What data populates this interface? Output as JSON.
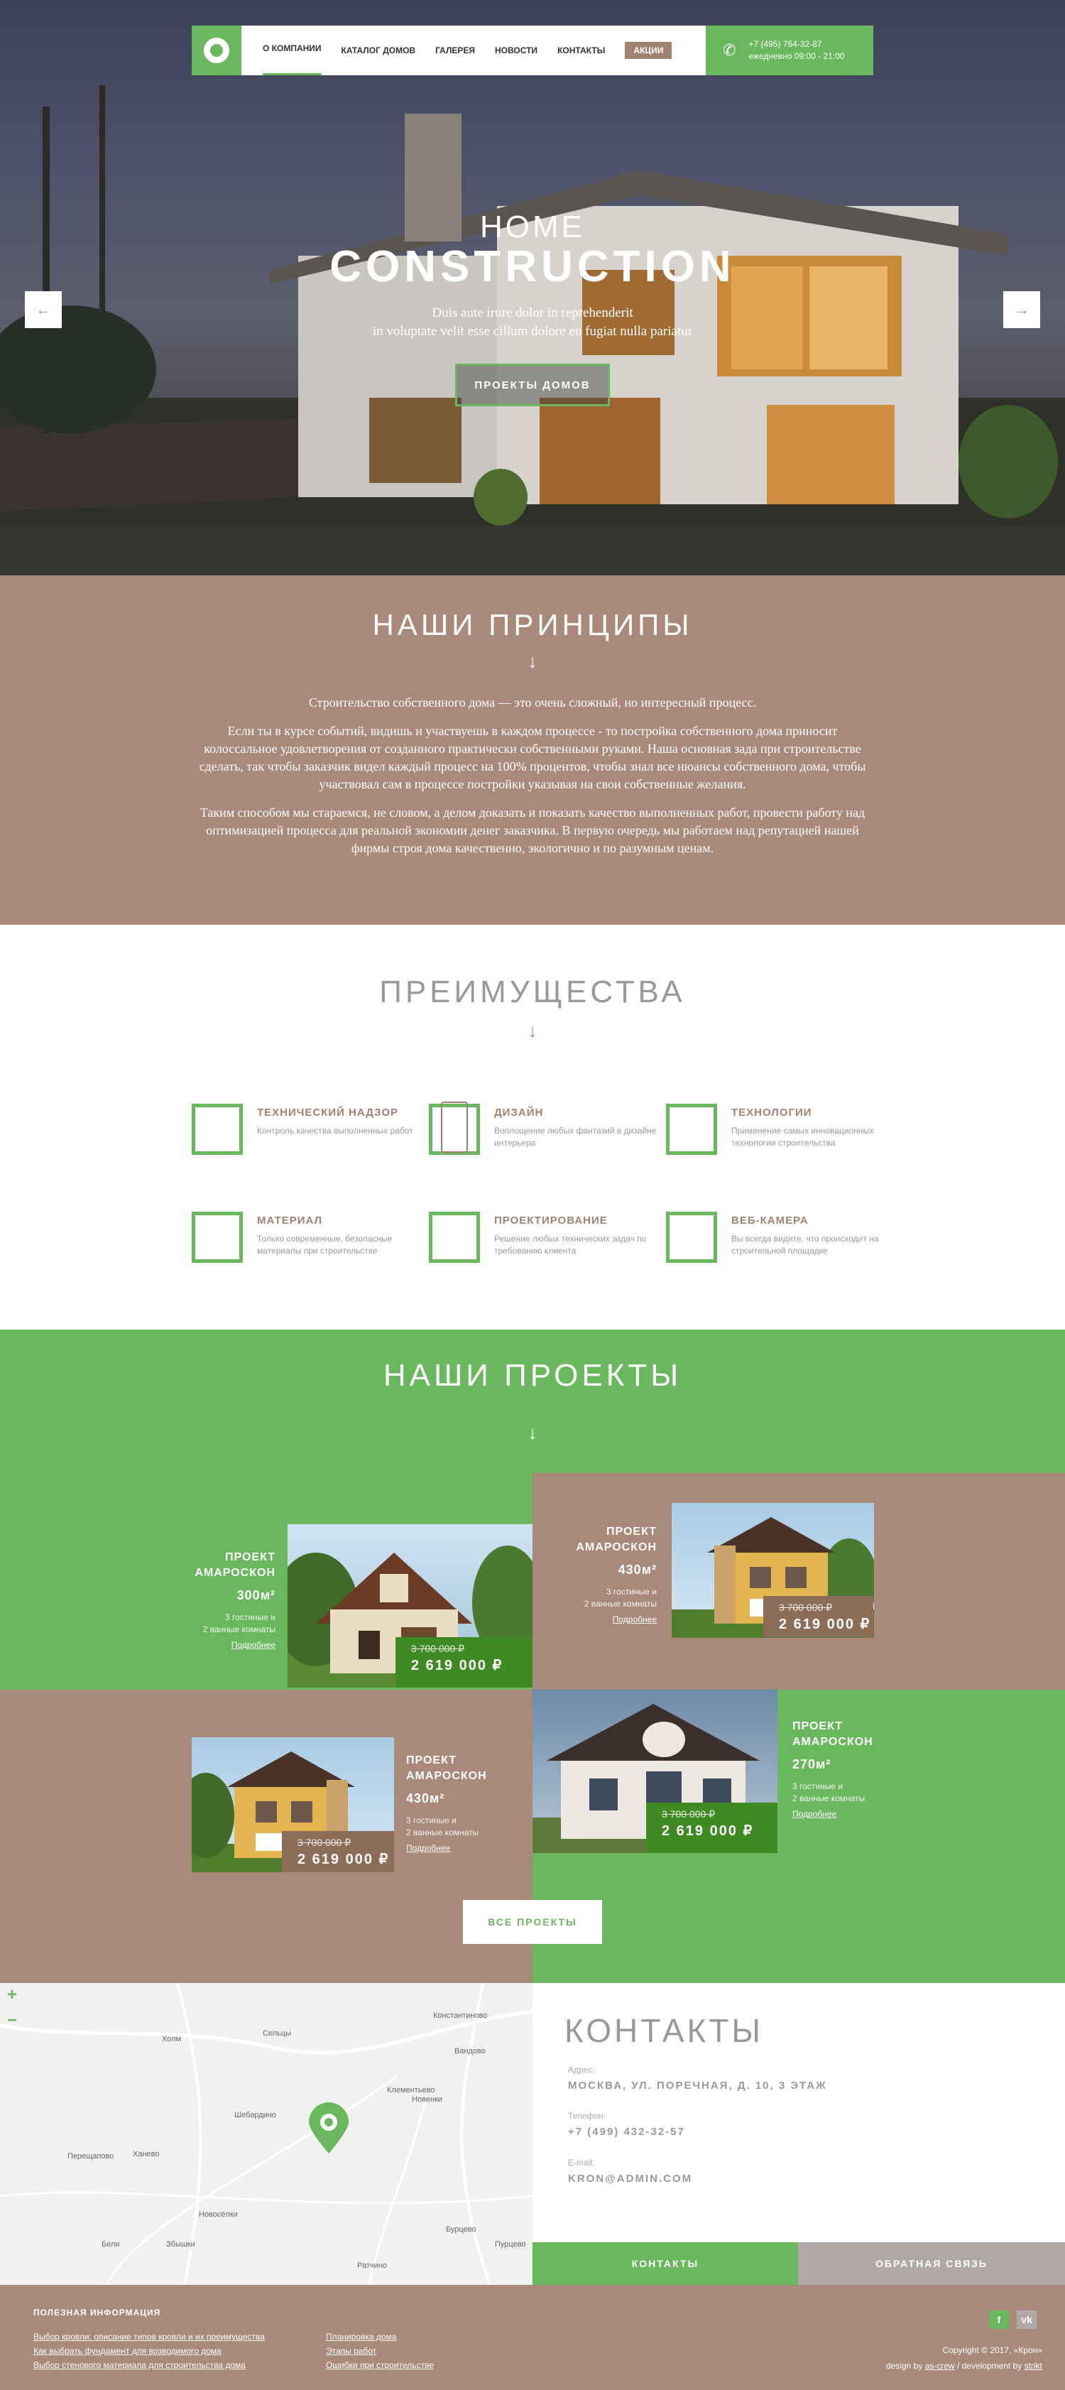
{
  "nav": {
    "items": [
      "О компании",
      "Каталог домов",
      "Галерея",
      "Новости",
      "Контакты"
    ],
    "promo": "Акции",
    "phone": "+7 (495) 764-32-87",
    "hours": "ежедневно 09:00 - 21:00"
  },
  "hero": {
    "title_small": "HOME",
    "title_big": "CONSTRUCTION",
    "subtitle_line1": "Duis aute irure dolor in reprehenderit",
    "subtitle_line2": "in voluptate velit esse cillum dolore eu fugiat nulla pariatur",
    "button": "ПРОЕКТЫ ДОМОВ",
    "prev": "←",
    "next": "→"
  },
  "principles": {
    "title": "НАШИ ПРИНЦИПЫ",
    "arrow": "↓",
    "p1": "Строительство собственного дома — это очень сложный, но интересный процесс.",
    "p2": "Если ты в курсе событий, видишь и участвуешь в каждом процессе - то постройка собственного дома приносит колоссальное удовлетворения от созданного практически собственными руками. Наша основная зада при строительстве сделать, так чтобы заказчик видел каждый процесс на 100% процентов, чтобы знал все нюансы собственного дома, чтобы участвовал сам в процессе постройки указывая на свои собственные желания.",
    "p3": "Таким способом мы стараемся, не словом, а делом доказать и показать качество выполненных работ, провести работу над оптимизацией процесса для реальной экономии денег заказчика. В первую очередь мы работаем над репутацией нашей фирмы строя дома качественно, экологично и по разумным ценам."
  },
  "advantages": {
    "title": "ПРЕИМУЩЕСТВА",
    "arrow": "↓",
    "items": [
      {
        "title": "Технический надзор",
        "desc": "Контроль качества выполненных работ"
      },
      {
        "title": "Дизайн",
        "desc": "Воплощение любых фантазий в дизайне интерьера"
      },
      {
        "title": "Технологии",
        "desc": "Применение самых инновационных технологии строительства"
      },
      {
        "title": "Материал",
        "desc": "Только современные, безопасные материалы при строительстве"
      },
      {
        "title": "Проектирование",
        "desc": "Решение любых технических задач по требованию клиента"
      },
      {
        "title": "Веб-камера",
        "desc": "Вы всегда видите, что происходит на строительной площадке"
      }
    ]
  },
  "projects": {
    "title": "НАШИ ПРОЕКТЫ",
    "arrow": "↓",
    "cards": [
      {
        "name_line1": "ПРОЕКТ",
        "name_line2": "АМАРОСКОН",
        "area": "300м²",
        "rooms_line1": "3 гостиные и",
        "rooms_line2": "2 ванные комнаты",
        "more": "Подробнее",
        "old_price": "3 700 000 ₽",
        "price": "2 619 000 ₽"
      },
      {
        "name_line1": "ПРОЕКТ",
        "name_line2": "АМАРОСКОН",
        "area": "430м²",
        "rooms_line1": "3 гостиные и",
        "rooms_line2": "2 ванные комнаты",
        "more": "Подробнее",
        "old_price": "3 700 000 ₽",
        "price": "2 619 000 ₽"
      },
      {
        "name_line1": "ПРОЕКТ",
        "name_line2": "АМАРОСКОН",
        "area": "430м²",
        "rooms_line1": "3 гостиные и",
        "rooms_line2": "2 ванные комнаты",
        "more": "Подробнее",
        "old_price": "3 700 000 ₽",
        "price": "2 619 000 ₽"
      },
      {
        "name_line1": "ПРОЕКТ",
        "name_line2": "АМАРОСКОН",
        "area": "270м²",
        "rooms_line1": "3 гостиные и",
        "rooms_line2": "2 ванные комнаты",
        "more": "Подробнее",
        "old_price": "3 700 000 ₽",
        "price": "2 619 000 ₽"
      }
    ],
    "all_button": "ВСЕ ПРОЕКТЫ"
  },
  "map": {
    "zoom_in": "+",
    "zoom_out": "−",
    "places": [
      "Холм",
      "Сельцы",
      "Константиново",
      "Вандово",
      "Клементьево",
      "Новенки",
      "Шебардино",
      "Перещапово",
      "Ханево",
      "Новосёлки",
      "Бели",
      "Збышки",
      "Ратчино",
      "Бурцево",
      "Пурцево"
    ]
  },
  "contacts": {
    "title": "КОНТАКТЫ",
    "address_label": "Адрес:",
    "address": "МОСКВА, УЛ. ПОРЕЧНАЯ, Д. 10, 3 ЭТАЖ",
    "phone_label": "Телефон:",
    "phone": "+7 (499) 432-32-57",
    "email_label": "E-mail:",
    "email": "KRON@ADMIN.COM",
    "tab_contacts": "КОНТАКТЫ",
    "tab_feedback": "ОБРАТНАЯ СВЯЗЬ"
  },
  "footer": {
    "title": "ПОЛЕЗНАЯ ИНФОРМАЦИЯ",
    "links_col1": [
      "Выбор кровли: описание типов кровли и их преимущества",
      "Как выбрать фундамент для возводимого дома",
      "Выбор стенового материала для строительства дома"
    ],
    "links_col2": [
      "Планировка дома",
      "Этапы работ",
      "Ошибки при строительстве"
    ],
    "social_fb": "f",
    "social_vk": "vk",
    "copyright": "Copyright ©  2017, «Крон»",
    "design_prefix": "design by",
    "design_by": "as-crew",
    "dev_prefix": "/ development by",
    "dev_by": "strikt"
  },
  "colors": {
    "green": "#6ab85e",
    "brown": "#a8897a",
    "dark_green": "#3f8a23",
    "dark_brown": "#8c6d57",
    "gray_tab": "#b0a7a7"
  }
}
